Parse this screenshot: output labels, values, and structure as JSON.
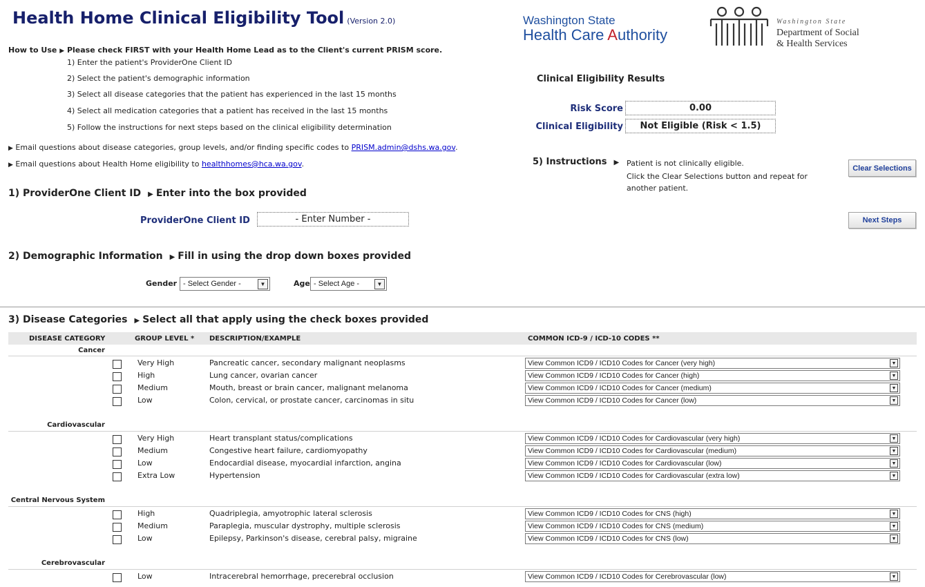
{
  "header": {
    "title": "Health Home Clinical Eligibility Tool",
    "version": "(Version 2.0)"
  },
  "logos": {
    "hca_line1": "Washington State",
    "hca_line2_prefix": "Health Care ",
    "hca_line2_a": "A",
    "hca_line2_suffix": "uthority",
    "dshs_small": "Washington State",
    "dshs_line1": "Department of Social",
    "dshs_line2": "& Health Services"
  },
  "how_to_use": {
    "label": "How to Use",
    "lead": "Please check FIRST with your Health Home Lead as to the Client's current PRISM score.",
    "steps": [
      "1) Enter the patient's ProviderOne Client ID",
      "2) Select the patient's demographic information",
      "3) Select all disease categories that the patient has experienced in the last 15 months",
      "4) Select all medication categories that a patient has received in the last 15 months",
      "5) Follow the instructions for next steps based on the clinical eligibility determination"
    ]
  },
  "emails": {
    "line1_text": "Email questions about disease categories, group levels, and/or finding specific codes  to ",
    "line1_link": "PRISM.admin@dshs.wa.gov",
    "line1_end": ".",
    "line2_text": "Email questions about Health Home eligibility to ",
    "line2_link": "healthhomes@hca.wa.gov",
    "line2_end": "."
  },
  "results": {
    "heading": "Clinical Eligibility Results",
    "risk_label": "Risk Score",
    "risk_value": "0.00",
    "elig_label": "Clinical Eligibility",
    "elig_value": "Not Eligible (Risk < 1.5)"
  },
  "instructions": {
    "heading": "5) Instructions",
    "line1": "Patient is not clinically eligible.",
    "line2": "Click the Clear Selections button and repeat for",
    "line3": "another patient."
  },
  "buttons": {
    "clear": "Clear Selections",
    "next": "Next Steps"
  },
  "section1": {
    "heading": "1) ProviderOne Client ID",
    "hint": "Enter into the box provided",
    "field_label": "ProviderOne Client ID",
    "field_value": "- Enter Number -"
  },
  "section2": {
    "heading": "2) Demographic Information",
    "hint": "Fill in using the drop down boxes provided",
    "gender_label": "Gender",
    "gender_value": "- Select Gender -",
    "age_label": "Age",
    "age_value": "- Select Age -"
  },
  "section3": {
    "heading": "3) Disease Categories",
    "hint": "Select all that apply using the check boxes provided",
    "columns": {
      "category": "DISEASE CATEGORY",
      "group": "GROUP LEVEL *",
      "desc": "DESCRIPTION/EXAMPLE",
      "codes": "COMMON ICD-9 / ICD-10 CODES **"
    },
    "categories": [
      {
        "name": "Cancer",
        "rows": [
          {
            "level": "Very High",
            "desc": "Pancreatic cancer, secondary malignant neoplasms",
            "codes": "View Common ICD9 / ICD10 Codes for Cancer (very high)"
          },
          {
            "level": "High",
            "desc": "Lung cancer, ovarian cancer",
            "codes": "View Common ICD9 / ICD10 Codes for Cancer (high)"
          },
          {
            "level": "Medium",
            "desc": "Mouth, breast or brain cancer, malignant melanoma",
            "codes": "View Common ICD9 / ICD10 Codes for Cancer (medium)"
          },
          {
            "level": "Low",
            "desc": "Colon, cervical, or prostate cancer, carcinomas in situ",
            "codes": "View Common ICD9 / ICD10 Codes for Cancer (low)"
          }
        ]
      },
      {
        "name": "Cardiovascular",
        "rows": [
          {
            "level": "Very High",
            "desc": "Heart transplant status/complications",
            "codes": "View Common ICD9 / ICD10 Codes for Cardiovascular (very high)"
          },
          {
            "level": "Medium",
            "desc": "Congestive heart failure, cardiomyopathy",
            "codes": "View Common ICD9 / ICD10 Codes for Cardiovascular (medium)"
          },
          {
            "level": "Low",
            "desc": "Endocardial disease, myocardial infarction, angina",
            "codes": "View Common ICD9 / ICD10 Codes for Cardiovascular (low)"
          },
          {
            "level": "Extra Low",
            "desc": "Hypertension",
            "codes": "View Common ICD9 / ICD10 Codes for Cardiovascular (extra low)"
          }
        ]
      },
      {
        "name": "Central Nervous System",
        "rows": [
          {
            "level": "High",
            "desc": "Quadriplegia, amyotrophic lateral sclerosis",
            "codes": "View Common ICD9 / ICD10 Codes for CNS (high)"
          },
          {
            "level": "Medium",
            "desc": "Paraplegia, muscular dystrophy, multiple sclerosis",
            "codes": "View Common ICD9 / ICD10 Codes for CNS (medium)"
          },
          {
            "level": "Low",
            "desc": "Epilepsy, Parkinson's disease, cerebral palsy, migraine",
            "codes": "View Common ICD9 / ICD10 Codes for CNS (low)"
          }
        ]
      },
      {
        "name": "Cerebrovascular",
        "rows": [
          {
            "level": "Low",
            "desc": "Intracerebral hemorrhage, precerebral occlusion",
            "codes": "View Common ICD9 / ICD10 Codes for Cerebrovascular (low)"
          }
        ]
      }
    ]
  }
}
